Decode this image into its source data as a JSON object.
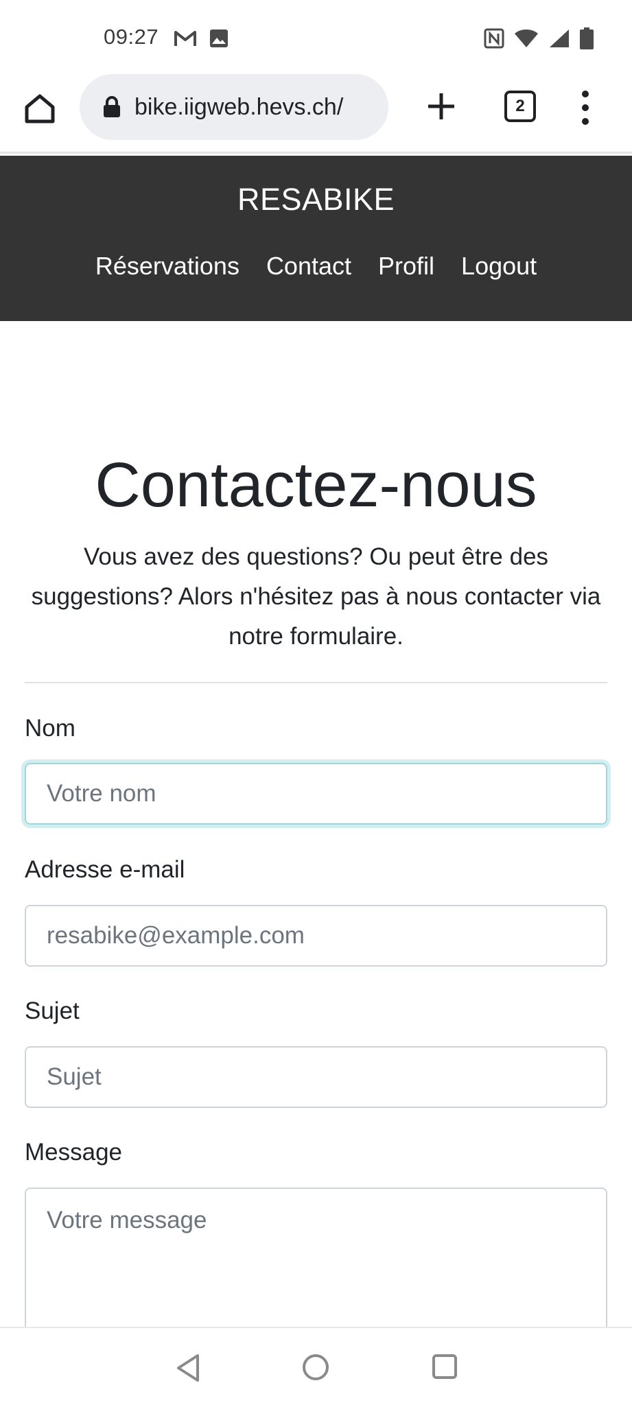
{
  "status_bar": {
    "time": "09:27",
    "left_icons": [
      "gmail-icon",
      "image-icon"
    ],
    "right_icons": [
      "nfc-icon",
      "wifi-icon",
      "signal-icon",
      "battery-icon"
    ]
  },
  "browser": {
    "url": "bike.iigweb.hevs.ch/",
    "tab_count": "2"
  },
  "header": {
    "brand": "RESABIKE",
    "nav": [
      "Réservations",
      "Contact",
      "Profil",
      "Logout"
    ]
  },
  "main": {
    "title": "Contactez-nous",
    "intro": "Vous avez des questions? Ou peut être des suggestions? Alors n'hésitez pas à nous contacter via notre formulaire.",
    "fields": {
      "name": {
        "label": "Nom",
        "placeholder": "Votre nom"
      },
      "email": {
        "label": "Adresse e-mail",
        "placeholder": "resabike@example.com"
      },
      "subject": {
        "label": "Sujet",
        "placeholder": "Sujet"
      },
      "message": {
        "label": "Message",
        "placeholder": "Votre message"
      }
    }
  },
  "colors": {
    "header_bg": "#343434",
    "focus_border": "#9fd6dc",
    "text": "#212529",
    "placeholder": "#6c757d"
  }
}
